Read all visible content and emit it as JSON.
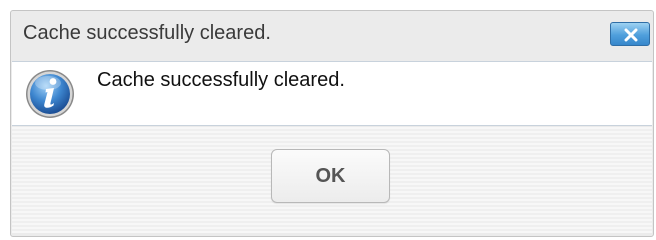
{
  "dialog": {
    "title": "Cache successfully cleared.",
    "close_icon": "close-x-icon",
    "message_icon": "info-icon",
    "message": "Cache successfully cleared.",
    "ok_label": "OK"
  },
  "colors": {
    "accent_blue": "#4f9fdc",
    "dialog_background": "#ebebeb",
    "content_background": "#ffffff"
  }
}
